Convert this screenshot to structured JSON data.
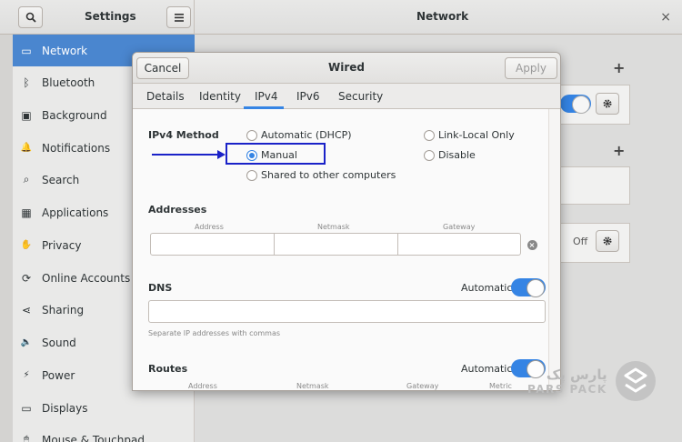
{
  "headerbar": {
    "settings_title": "Settings",
    "network_title": "Network",
    "close_glyph": "×"
  },
  "sidebar": {
    "items": [
      {
        "label": "Network",
        "icon": "network-icon",
        "glyph": "▭"
      },
      {
        "label": "Bluetooth",
        "icon": "bluetooth-icon",
        "glyph": "ᛒ"
      },
      {
        "label": "Background",
        "icon": "background-icon",
        "glyph": "▣"
      },
      {
        "label": "Notifications",
        "icon": "bell-icon",
        "glyph": "🔔"
      },
      {
        "label": "Search",
        "icon": "search-icon",
        "glyph": "⌕"
      },
      {
        "label": "Applications",
        "icon": "applications-icon",
        "glyph": "▦"
      },
      {
        "label": "Privacy",
        "icon": "privacy-icon",
        "glyph": "✋"
      },
      {
        "label": "Online Accounts",
        "icon": "online-accounts-icon",
        "glyph": "⟳"
      },
      {
        "label": "Sharing",
        "icon": "sharing-icon",
        "glyph": "⋖"
      },
      {
        "label": "Sound",
        "icon": "sound-icon",
        "glyph": "🔈"
      },
      {
        "label": "Power",
        "icon": "power-icon",
        "glyph": "⚡"
      },
      {
        "label": "Displays",
        "icon": "displays-icon",
        "glyph": "▭"
      },
      {
        "label": "Mouse & Touchpad",
        "icon": "mouse-icon",
        "glyph": "🖱"
      }
    ]
  },
  "background": {
    "plus": "+",
    "off_label": "Off"
  },
  "dialog": {
    "title": "Wired",
    "cancel_label": "Cancel",
    "apply_label": "Apply",
    "tabs": [
      "Details",
      "Identity",
      "IPv4",
      "IPv6",
      "Security"
    ],
    "active_tab": "IPv4",
    "ipv4_method_label": "IPv4 Method",
    "methods": {
      "automatic": "Automatic (DHCP)",
      "manual": "Manual",
      "shared": "Shared to other computers",
      "link_local": "Link-Local Only",
      "disable": "Disable"
    },
    "selected_method": "Manual",
    "addresses": {
      "title": "Addresses",
      "columns": [
        "Address",
        "Netmask",
        "Gateway"
      ]
    },
    "dns": {
      "title": "DNS",
      "automatic_label": "Automatic",
      "hint": "Separate IP addresses with commas"
    },
    "routes": {
      "title": "Routes",
      "automatic_label": "Automatic",
      "columns": [
        "Address",
        "Netmask",
        "Gateway",
        "Metric"
      ]
    }
  },
  "watermark": {
    "main": "پارس پک",
    "sub": "PARS PACK"
  },
  "colors": {
    "accent": "#3584e4",
    "selection": "#4a86cf",
    "highlight_box": "#1a22c8"
  }
}
